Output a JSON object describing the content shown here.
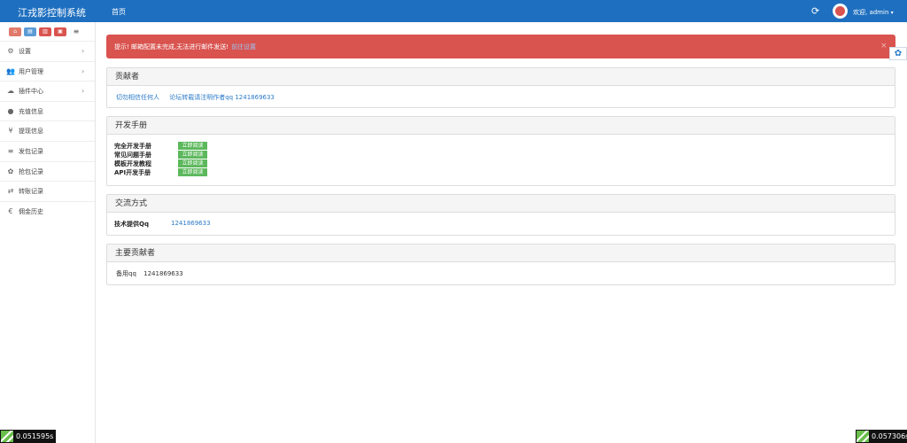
{
  "header": {
    "brand": "江戎影控制系统",
    "nav_home": "首页",
    "refresh_icon": "refresh-icon",
    "user": "欢迎, admin",
    "caret": "▾"
  },
  "shortcuts": {
    "home_icon": "home-icon",
    "doc_icon": "document-icon",
    "trash_icon": "trash-icon",
    "print_icon": "print-icon",
    "list_icon": "list-icon"
  },
  "sidebar": {
    "items": [
      {
        "label": "设置",
        "icon": "⚙",
        "chevron": "›"
      },
      {
        "label": "用户管理",
        "icon": "👥",
        "chevron": "›"
      },
      {
        "label": "插件中心",
        "icon": "☁",
        "chevron": "›"
      },
      {
        "label": "充值信息",
        "icon": "●",
        "chevron": ""
      },
      {
        "label": "提现信息",
        "icon": "¥",
        "chevron": ""
      },
      {
        "label": "发包记录",
        "icon": "≡",
        "chevron": ""
      },
      {
        "label": "抢包记录",
        "icon": "✿",
        "chevron": ""
      },
      {
        "label": "转账记录",
        "icon": "⇄",
        "chevron": ""
      },
      {
        "label": "佣金历史",
        "icon": "€",
        "chevron": ""
      }
    ]
  },
  "alert": {
    "text": "提示! 邮箱配置未完成,无法进行邮件发送!",
    "link": "前往设置",
    "close": "×"
  },
  "float_button_icon": "share-icon",
  "panels": {
    "contributors": {
      "title": "贡献者",
      "link1": "切勿相信任何人",
      "link2": "论坛转载请注明作者qq 1241869633"
    },
    "manual": {
      "title": "开发手册",
      "rows": [
        {
          "label": "完全开发手册",
          "button": "立即阅读"
        },
        {
          "label": "常见问题手册",
          "button": "立即阅读"
        },
        {
          "label": "模板开发教程",
          "button": "立即阅读"
        },
        {
          "label": "API开发手册",
          "button": "立即阅读"
        }
      ]
    },
    "contact": {
      "title": "交流方式",
      "label": "技术提供Qq",
      "value": "1241869633"
    },
    "main_contributors": {
      "title": "主要贡献者",
      "label": "备用qq",
      "value": "1241869633"
    }
  },
  "timers": {
    "left": "0.051595s",
    "right": "0.057306s"
  },
  "colors": {
    "topbar": "#1e6fbf",
    "alert": "#d9534f",
    "button_green": "#5cb85c",
    "link": "#2a7ac8"
  }
}
